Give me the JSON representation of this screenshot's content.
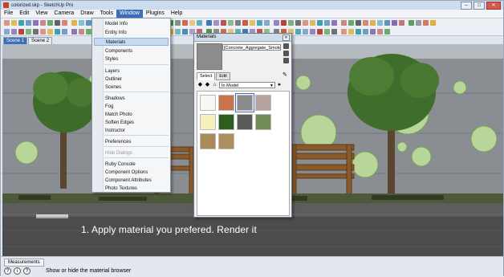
{
  "window": {
    "title": "colorized.skp - SketchUp Pro",
    "buttons": {
      "minimize": "–",
      "maximize": "□",
      "close": "✕"
    }
  },
  "menubar": {
    "items": [
      "File",
      "Edit",
      "View",
      "Camera",
      "Draw",
      "Tools",
      "Window",
      "Plugins",
      "Help"
    ],
    "active": "Window"
  },
  "scene_tabs": [
    "Scene 1",
    "Scene 2"
  ],
  "window_menu": {
    "items": [
      {
        "label": "Model Info",
        "state": "normal"
      },
      {
        "label": "Entity Info",
        "state": "normal"
      },
      {
        "label": "Materials",
        "state": "highlighted"
      },
      {
        "label": "Components",
        "state": "normal"
      },
      {
        "label": "Styles",
        "state": "normal"
      },
      {
        "label": "Layers",
        "state": "normal"
      },
      {
        "label": "Outliner",
        "state": "normal"
      },
      {
        "label": "Scenes",
        "state": "normal"
      },
      {
        "label": "Shadows",
        "state": "normal"
      },
      {
        "label": "Fog",
        "state": "normal"
      },
      {
        "label": "Match Photo",
        "state": "normal"
      },
      {
        "label": "Soften Edges",
        "state": "normal"
      },
      {
        "label": "Instructor",
        "state": "normal"
      },
      {
        "label": "Preferences",
        "state": "normal"
      },
      {
        "label": "Hide Dialogs",
        "state": "disabled"
      },
      {
        "label": "Ruby Console",
        "state": "normal"
      },
      {
        "label": "Component Options",
        "state": "normal"
      },
      {
        "label": "Component Attributes",
        "state": "normal"
      },
      {
        "label": "Photo Textures",
        "state": "normal"
      }
    ]
  },
  "materials_panel": {
    "title": "Materials",
    "close": "✕",
    "material_name": "[Concrete_Aggregate_Smoke]",
    "tabs": [
      "Select",
      "Edit"
    ],
    "active_tab": "Select",
    "library": "In Model",
    "icons": {
      "back": "◆",
      "forward": "◆",
      "home": "⌂",
      "details": "▸",
      "dropper": "✎"
    },
    "swatches": [
      {
        "name": "tree-material-swatch",
        "color": "#f4f7f2",
        "selected": false
      },
      {
        "name": "terracotta-material-swatch",
        "color": "#c8734b",
        "selected": false
      },
      {
        "name": "concrete-aggregate-smoke-swatch",
        "color": "#8a8a8a",
        "selected": true
      },
      {
        "name": "brick-material-swatch",
        "color": "#b7a29c",
        "selected": false
      },
      {
        "name": "cream-material-swatch",
        "color": "#f6f0be",
        "selected": false
      },
      {
        "name": "grass-material-swatch",
        "color": "#2f5d20",
        "selected": false
      },
      {
        "name": "dark-gray-material-swatch",
        "color": "#5a5a5a",
        "selected": false
      },
      {
        "name": "foliage-material-swatch",
        "color": "#6f8c56",
        "selected": false
      },
      {
        "name": "bird-material-swatch-1",
        "color": "#a98b5a",
        "selected": false
      },
      {
        "name": "bird-material-swatch-2",
        "color": "#b08f5e",
        "selected": false
      }
    ]
  },
  "caption": "1. Apply material you prefered. Render it",
  "statusbar": {
    "measurements_tab": "Measurements",
    "status_text": "Show or hide the material browser",
    "icons": [
      "?",
      "i",
      "?"
    ]
  }
}
